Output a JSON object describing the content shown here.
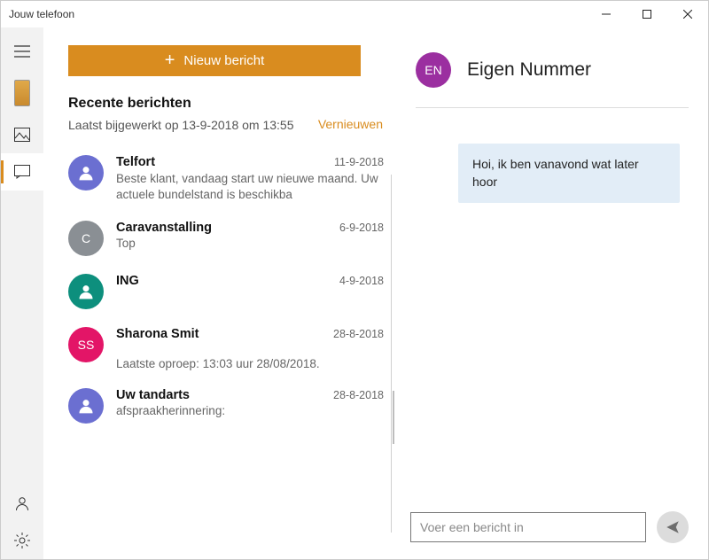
{
  "window": {
    "title": "Jouw telefoon"
  },
  "sidebar": {
    "items": [
      "menu",
      "phone",
      "photos",
      "messages"
    ],
    "bottom": [
      "person",
      "settings"
    ]
  },
  "left": {
    "new_message": "Nieuw bericht",
    "section_title": "Recente berichten",
    "updated": "Laatst bijgewerkt op 13-9-2018 om 13:55",
    "refresh": "Vernieuwen",
    "conversations": [
      {
        "name": "Telfort",
        "date": "11-9-2018",
        "preview": "Beste klant, vandaag start uw nieuwe maand. Uw actuele bundelstand is beschikba",
        "avatar_color": "#6b6fd1",
        "avatar_type": "person",
        "initials": ""
      },
      {
        "name": "Caravanstalling",
        "date": "6-9-2018",
        "preview": "Top",
        "avatar_color": "#8a8f94",
        "avatar_type": "initials",
        "initials": "C"
      },
      {
        "name": "ING",
        "date": "4-9-2018",
        "preview": "",
        "avatar_color": "#0d8f7d",
        "avatar_type": "person",
        "initials": ""
      },
      {
        "name": "Sharona Smit",
        "date": "28-8-2018",
        "preview": "Laatste oproep: 13:03 uur 28/08/2018.",
        "avatar_color": "#e31567",
        "avatar_type": "initials",
        "initials": "SS"
      },
      {
        "name": "Uw tandarts",
        "date": "28-8-2018",
        "preview": " afspraakherinnering:",
        "avatar_color": "#6b6fd1",
        "avatar_type": "person",
        "initials": ""
      }
    ]
  },
  "right": {
    "avatar_initials": "EN",
    "title": "Eigen Nummer",
    "messages": [
      {
        "text": "Hoi, ik ben vanavond wat later hoor"
      }
    ],
    "compose_placeholder": "Voer een bericht in"
  }
}
